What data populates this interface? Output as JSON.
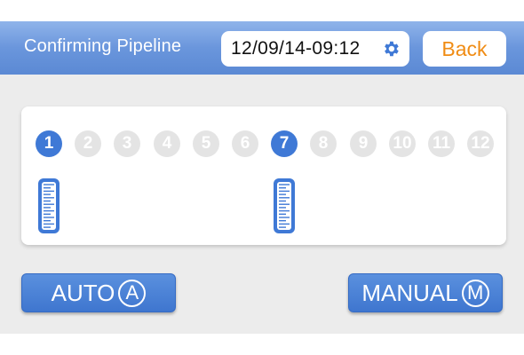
{
  "header": {
    "title": "Confirming Pipeline",
    "datetime": "12/09/14-09:12",
    "settings_icon": "gear-icon",
    "back_label": "Back"
  },
  "pipelines": {
    "numbers": [
      "1",
      "2",
      "3",
      "4",
      "5",
      "6",
      "7",
      "8",
      "9",
      "10",
      "11",
      "12"
    ],
    "active": [
      "1",
      "7"
    ]
  },
  "buttons": {
    "auto_label": "AUTO",
    "auto_letter": "A",
    "manual_label": "MANUAL",
    "manual_letter": "M"
  },
  "colors": {
    "header": "#6a96dc",
    "active": "#3f79d6",
    "inactive": "#e4e4e4",
    "back_text": "#f08c14"
  }
}
